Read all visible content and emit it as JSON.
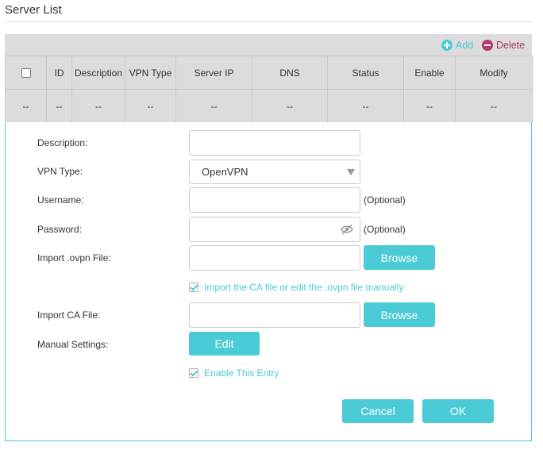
{
  "section": {
    "title": "Server List"
  },
  "toolbar": {
    "add_label": "Add",
    "delete_label": "Delete"
  },
  "table": {
    "columns": [
      "ID",
      "Description",
      "VPN Type",
      "Server IP",
      "DNS",
      "Status",
      "Enable",
      "Modify"
    ],
    "empty_row": [
      "--",
      "--",
      "--",
      "--",
      "--",
      "--",
      "--",
      "--",
      "--"
    ]
  },
  "form": {
    "description_label": "Description:",
    "description_value": "",
    "vpn_type_label": "VPN Type:",
    "vpn_type_value": "OpenVPN",
    "username_label": "Username:",
    "username_value": "",
    "password_label": "Password:",
    "password_value": "",
    "optional_text": "(Optional)",
    "import_ovpn_label": "Import .ovpn File:",
    "import_ovpn_value": "",
    "browse_label": "Browse",
    "import_ca_manual_label": "Import the CA file or edit the .ovpn file manually",
    "import_ca_manual_checked": true,
    "import_ca_label": "Import CA File:",
    "import_ca_value": "",
    "manual_settings_label": "Manual Settings:",
    "edit_label": "Edit",
    "enable_entry_label": "Enable This Entry",
    "enable_entry_checked": true,
    "cancel_label": "Cancel",
    "ok_label": "OK"
  },
  "colors": {
    "accent": "#4acbd6",
    "delete": "#b3386d",
    "header_bg": "#dcdcdc"
  },
  "icons": {
    "add": "plus-circle-icon",
    "delete": "minus-circle-icon",
    "password_toggle": "eye-slash-icon",
    "dropdown": "caret-down-icon"
  }
}
